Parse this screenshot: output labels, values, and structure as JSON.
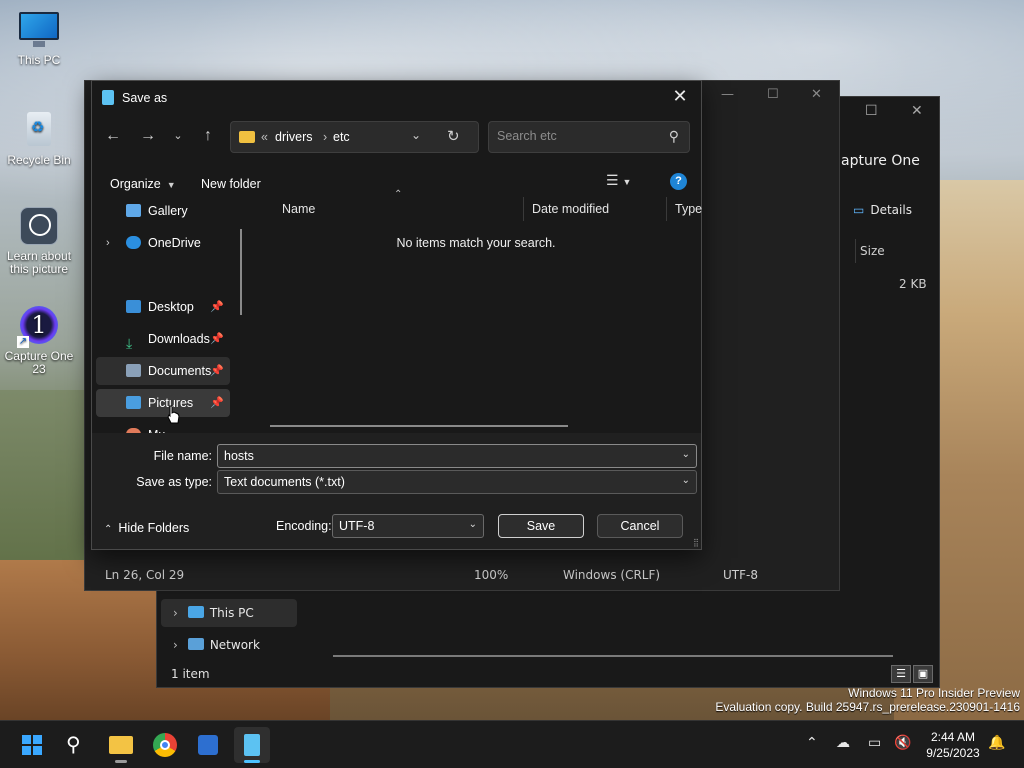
{
  "desktop": {
    "icons": [
      {
        "label": "This PC",
        "icon": "monitor-icon"
      },
      {
        "label": "Recycle Bin",
        "icon": "recycle-bin-icon"
      },
      {
        "label": "Learn about this picture",
        "icon": "learn-icon"
      },
      {
        "label": "Capture One 23",
        "icon": "capture-one-icon"
      }
    ],
    "watermark": {
      "line1": "Windows 11 Pro Insider Preview",
      "line2": "Evaluation copy. Build 25947.rs_prerelease.230901-1416"
    }
  },
  "explorer": {
    "heading": "apture One",
    "details_label": "Details",
    "size_header": "Size",
    "size_value": "2 KB",
    "nav": [
      {
        "label": "This PC",
        "icon": "this-pc-icon"
      },
      {
        "label": "Network",
        "icon": "network-icon"
      }
    ],
    "status": "1 item"
  },
  "notepad": {
    "status": {
      "position": "Ln 26, Col 29",
      "zoom": "100%",
      "line_ending": "Windows (CRLF)",
      "encoding": "UTF-8"
    }
  },
  "dialog": {
    "title": "Save as",
    "address": {
      "overflow": "«",
      "crumbs": [
        "drivers",
        "etc"
      ]
    },
    "search": {
      "placeholder": "Search etc"
    },
    "commands": {
      "organize": "Organize",
      "new_folder": "New folder"
    },
    "nav_items": [
      {
        "label": "Gallery",
        "icon": "gallery-icon",
        "pinned": false
      },
      {
        "label": "OneDrive",
        "icon": "onedrive-icon",
        "pinned": false
      },
      {
        "label": "Desktop",
        "icon": "desktop-icon",
        "pinned": true
      },
      {
        "label": "Downloads",
        "icon": "downloads-icon",
        "pinned": true
      },
      {
        "label": "Documents",
        "icon": "documents-icon",
        "pinned": true
      },
      {
        "label": "Pictures",
        "icon": "pictures-icon",
        "pinned": true
      },
      {
        "label": "Mu",
        "icon": "music-icon",
        "pinned": false
      }
    ],
    "columns": [
      "Name",
      "Date modified",
      "Type"
    ],
    "empty_message": "No items match your search.",
    "file_name_label": "File name:",
    "file_name_value": "hosts",
    "save_type_label": "Save as type:",
    "save_type_value": "Text documents (*.txt)",
    "hide_folders": "Hide Folders",
    "encoding_label": "Encoding:",
    "encoding_value": "UTF-8",
    "save_button": "Save",
    "cancel_button": "Cancel"
  },
  "taskbar": {
    "apps": [
      {
        "name": "start",
        "icon": "windows-logo-icon"
      },
      {
        "name": "search",
        "icon": "search-icon"
      },
      {
        "name": "file-explorer",
        "icon": "file-explorer-icon"
      },
      {
        "name": "chrome",
        "icon": "chrome-icon"
      },
      {
        "name": "store",
        "icon": "store-icon"
      },
      {
        "name": "notepad",
        "icon": "notepad-icon"
      }
    ],
    "time": "2:44 AM",
    "date": "9/25/2023"
  },
  "colors": {
    "accent": "#4cc2ff",
    "dialog_bg": "#191919",
    "panel_bg": "#202020",
    "folder": "#f0c040",
    "help": "#1f85d6"
  }
}
